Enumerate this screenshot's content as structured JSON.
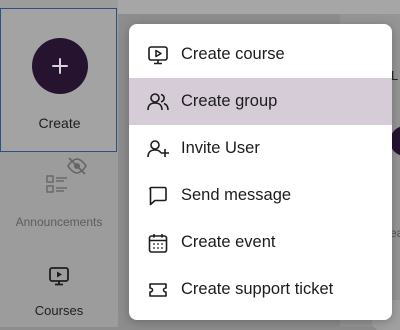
{
  "sidebar": {
    "create_label": "Create",
    "announcements_label": "Announcements",
    "courses_label": "Courses"
  },
  "background": {
    "right_fragment_top": "L",
    "right_fragment_mid": "ea"
  },
  "menu": {
    "items": [
      {
        "label": "Create course",
        "icon": "presentation-icon"
      },
      {
        "label": "Create group",
        "icon": "users-icon"
      },
      {
        "label": "Invite User",
        "icon": "user-plus-icon"
      },
      {
        "label": "Send message",
        "icon": "message-icon"
      },
      {
        "label": "Create event",
        "icon": "calendar-icon"
      },
      {
        "label": "Create support ticket",
        "icon": "ticket-icon"
      }
    ],
    "highlighted_item": "Create group"
  },
  "colors": {
    "accent": "#25132f",
    "highlight": "#d5ccd8",
    "focus_border": "#2b4f86"
  }
}
